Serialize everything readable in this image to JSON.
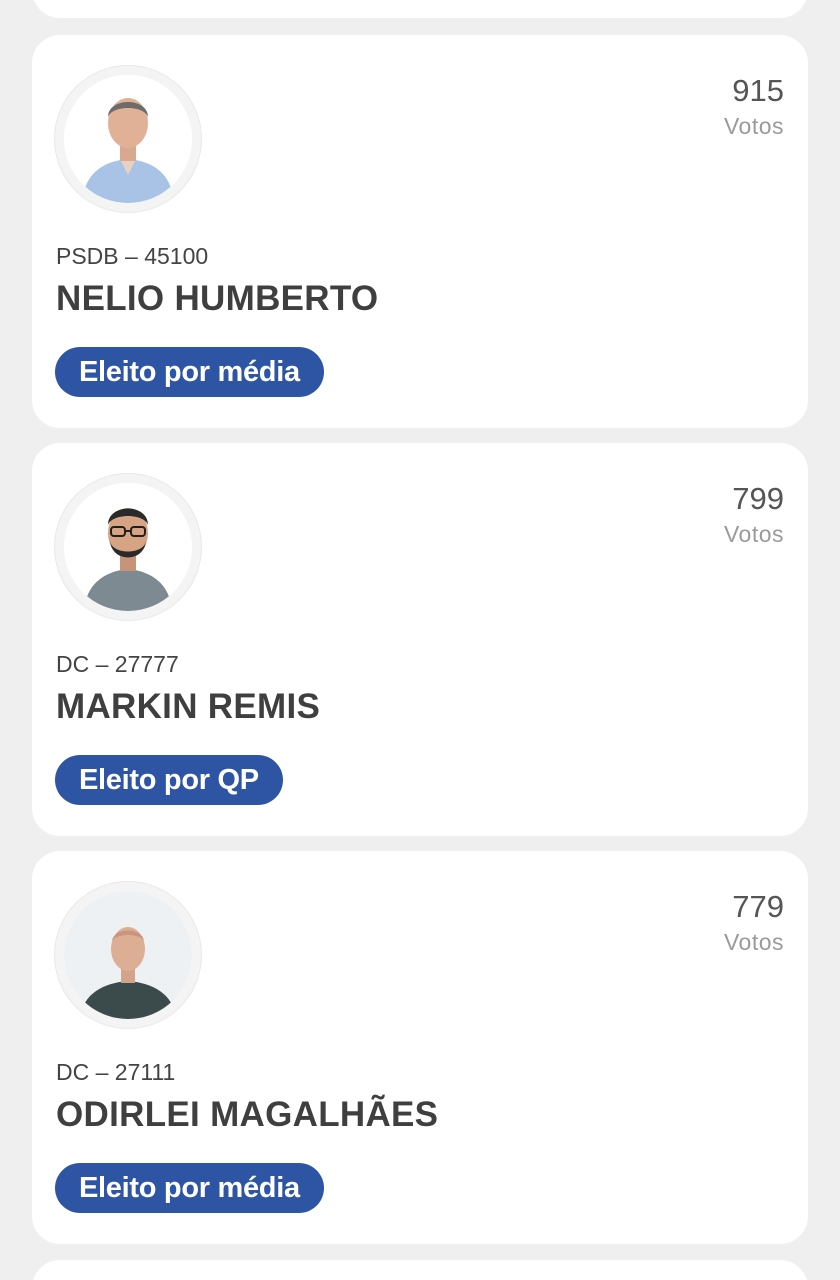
{
  "candidates": [
    {
      "votes": "915",
      "votes_label": "Votos",
      "party_number": "PSDB – 45100",
      "name": "NELIO HUMBERTO",
      "status": "Eleito por média",
      "photo": "candidate-photo"
    },
    {
      "votes": "799",
      "votes_label": "Votos",
      "party_number": "DC – 27777",
      "name": "MARKIN REMIS",
      "status": "Eleito por QP",
      "photo": "candidate-photo"
    },
    {
      "votes": "779",
      "votes_label": "Votos",
      "party_number": "DC – 27111",
      "name": "ODIRLEI MAGALHÃES",
      "status": "Eleito por média",
      "photo": "candidate-photo"
    }
  ],
  "colors": {
    "badge_bg": "#2e55a3",
    "card_bg": "#ffffff",
    "page_bg": "#efefef",
    "name_text": "#3f3f3f",
    "votes_text": "#555555",
    "votes_label_text": "#9a9a9a"
  }
}
